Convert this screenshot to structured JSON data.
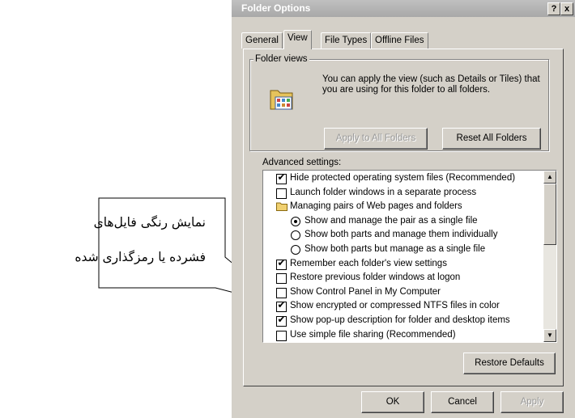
{
  "window": {
    "title": "Folder Options",
    "help_label": "?",
    "close_label": "x"
  },
  "tabs": [
    {
      "label": "General",
      "active": false
    },
    {
      "label": "View",
      "active": true
    },
    {
      "label": "File Types",
      "active": false
    },
    {
      "label": "Offline Files",
      "active": false
    }
  ],
  "folder_views": {
    "label": "Folder views",
    "description": "You can apply the view (such as Details or Tiles) that you are using for this folder to all folders.",
    "apply_label": "Apply to All Folders",
    "reset_label": "Reset All Folders",
    "icon": "folder-settings-icon"
  },
  "advanced": {
    "label": "Advanced settings:",
    "items": [
      {
        "type": "checkbox",
        "checked": true,
        "indent": 1,
        "label": "Hide protected operating system files (Recommended)"
      },
      {
        "type": "checkbox",
        "checked": false,
        "indent": 1,
        "label": "Launch folder windows in a separate process"
      },
      {
        "type": "folder",
        "indent": 1,
        "label": "Managing pairs of Web pages and folders"
      },
      {
        "type": "radio",
        "checked": true,
        "indent": 2,
        "label": "Show and manage the pair as a single file"
      },
      {
        "type": "radio",
        "checked": false,
        "indent": 2,
        "label": "Show both parts and manage them individually"
      },
      {
        "type": "radio",
        "checked": false,
        "indent": 2,
        "label": "Show both parts but manage as a single file"
      },
      {
        "type": "checkbox",
        "checked": true,
        "indent": 1,
        "label": "Remember each folder's view settings"
      },
      {
        "type": "checkbox",
        "checked": false,
        "indent": 1,
        "label": "Restore previous folder windows at logon"
      },
      {
        "type": "checkbox",
        "checked": false,
        "indent": 1,
        "label": "Show Control Panel in My Computer"
      },
      {
        "type": "checkbox",
        "checked": true,
        "indent": 1,
        "label": "Show encrypted or compressed NTFS files in color"
      },
      {
        "type": "checkbox",
        "checked": true,
        "indent": 1,
        "label": "Show pop-up description for folder and desktop items"
      },
      {
        "type": "checkbox",
        "checked": false,
        "indent": 1,
        "label": "Use simple file sharing (Recommended)"
      }
    ],
    "restore_label": "Restore Defaults"
  },
  "footer": {
    "ok_label": "OK",
    "cancel_label": "Cancel",
    "apply_label": "Apply"
  },
  "callout": {
    "line1": "نمایش رنگی فایل‌های",
    "line2": "فشرده یا رمزگذاری شده"
  }
}
